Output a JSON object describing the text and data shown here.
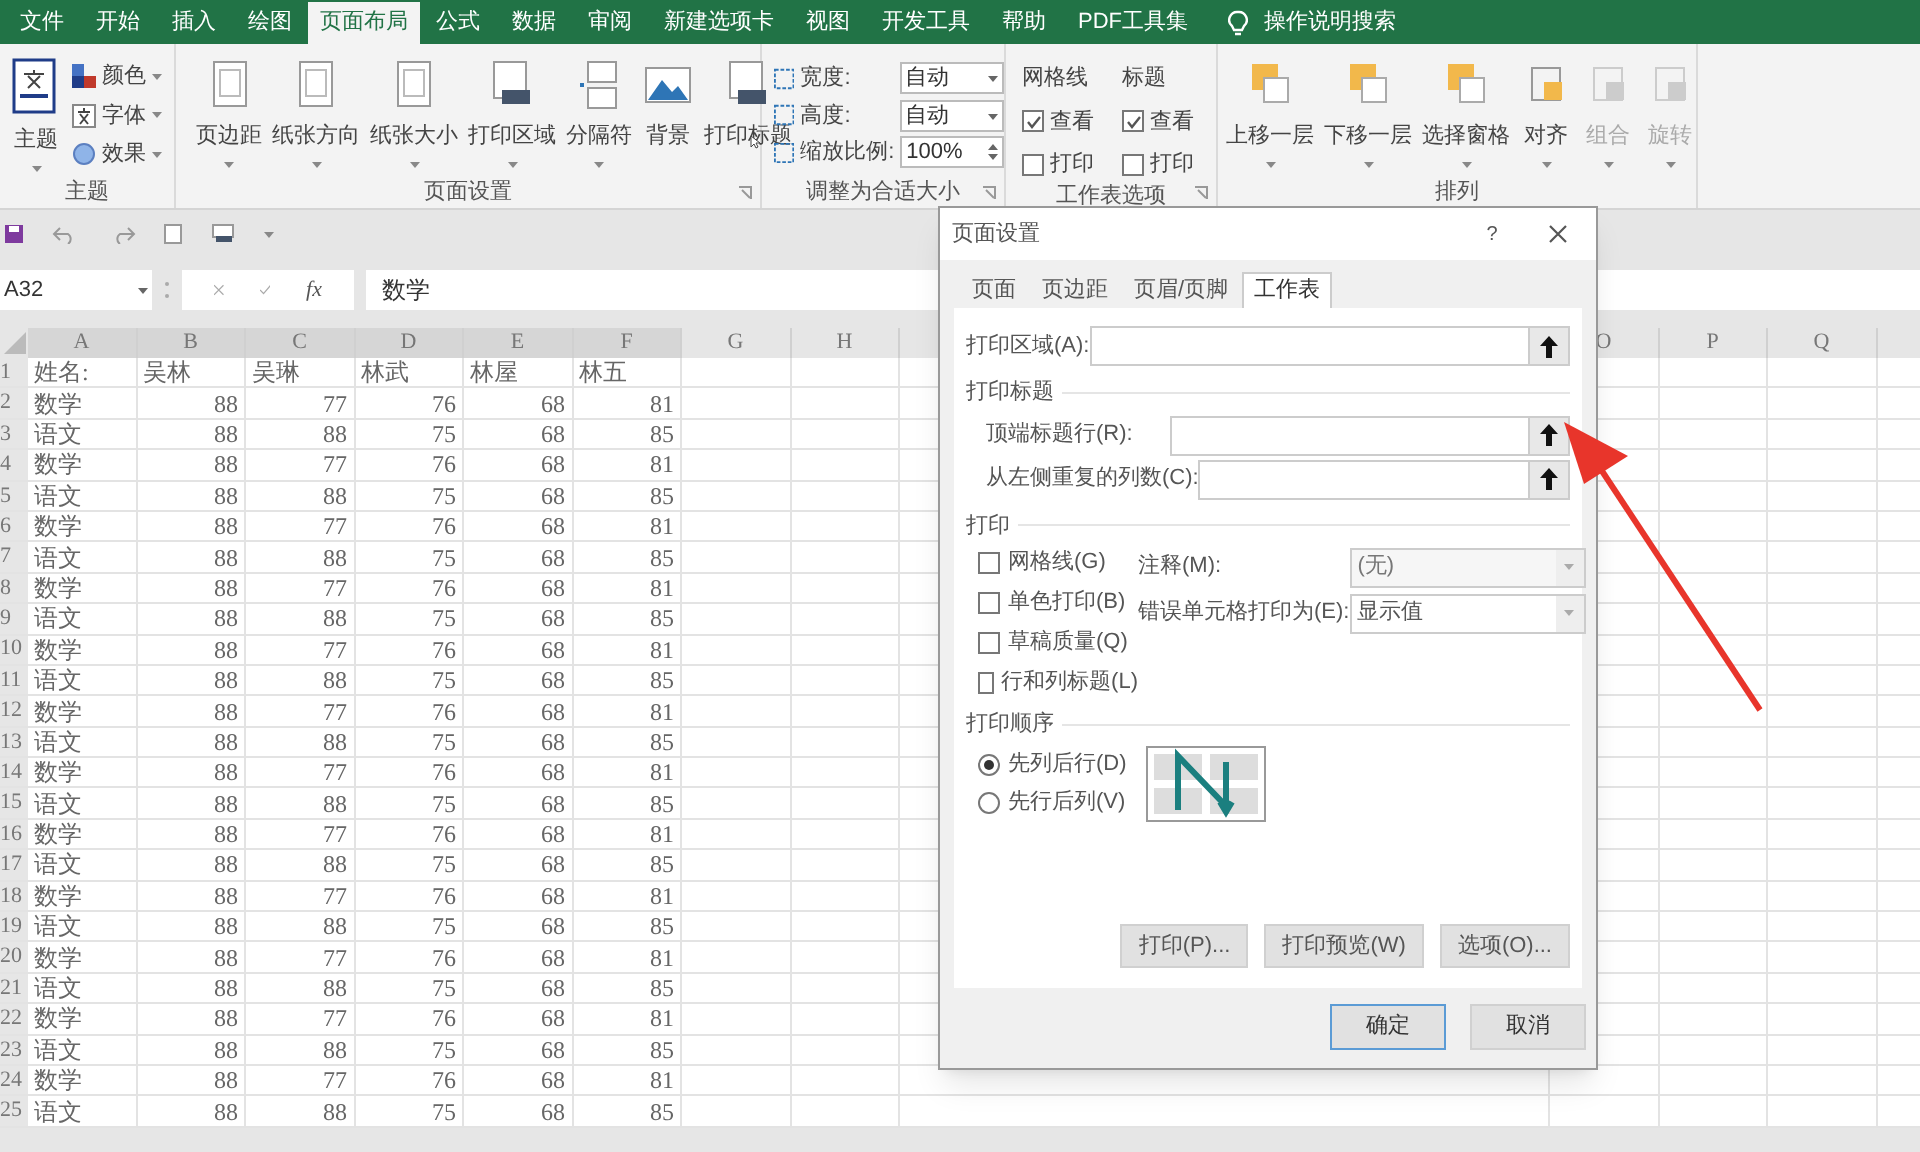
{
  "ribbon_tabs": [
    {
      "label": "文件",
      "selected": false
    },
    {
      "label": "开始",
      "selected": false
    },
    {
      "label": "插入",
      "selected": false
    },
    {
      "label": "绘图",
      "selected": false
    },
    {
      "label": "页面布局",
      "selected": true
    },
    {
      "label": "公式",
      "selected": false
    },
    {
      "label": "数据",
      "selected": false
    },
    {
      "label": "审阅",
      "selected": false
    },
    {
      "label": "新建选项卡",
      "selected": false
    },
    {
      "label": "视图",
      "selected": false
    },
    {
      "label": "开发工具",
      "selected": false
    },
    {
      "label": "帮助",
      "selected": false
    },
    {
      "label": "PDF工具集",
      "selected": false
    }
  ],
  "tell_me": "操作说明搜索",
  "theme_group": {
    "label": "主题",
    "button": "主题",
    "items": [
      "颜色",
      "字体",
      "效果"
    ]
  },
  "page_setup_group": {
    "label": "页面设置",
    "buttons": [
      "页边距",
      "纸张方向",
      "纸张大小",
      "打印区域",
      "分隔符",
      "背景",
      "打印标题"
    ]
  },
  "scale_group": {
    "label": "调整为合适大小",
    "fields": [
      {
        "label": "宽度:",
        "value": "自动"
      },
      {
        "label": "高度:",
        "value": "自动"
      },
      {
        "label": "缩放比例:",
        "value": "100%"
      }
    ]
  },
  "sheet_options_group": {
    "label": "工作表选项",
    "columns": [
      {
        "title": "网格线",
        "view_checked": true,
        "view": "查看",
        "print_checked": false,
        "print": "打印"
      },
      {
        "title": "标题",
        "view_checked": true,
        "view": "查看",
        "print_checked": false,
        "print": "打印"
      }
    ]
  },
  "arrange_group": {
    "label": "排列",
    "buttons": [
      {
        "label": "上移一层",
        "disabled": false
      },
      {
        "label": "下移一层",
        "disabled": false
      },
      {
        "label": "选择窗格",
        "disabled": false
      },
      {
        "label": "对齐",
        "disabled": false
      },
      {
        "label": "组合",
        "disabled": true
      },
      {
        "label": "旋转",
        "disabled": true
      }
    ]
  },
  "formula_bar": {
    "name_box": "A32",
    "function_label": "fx",
    "content": "数学"
  },
  "sheet": {
    "columns_left": [
      "A",
      "B",
      "C",
      "D",
      "E",
      "F",
      "G",
      "H"
    ],
    "columns_right": [
      "O",
      "P",
      "Q"
    ],
    "rows": [
      {
        "number": "1",
        "cells": [
          "姓名:",
          "吴林",
          "吴琳",
          "林武",
          "林屋",
          "林五"
        ]
      },
      {
        "number": "2",
        "cells": [
          "数学",
          "88",
          "77",
          "76",
          "68",
          "81"
        ]
      },
      {
        "number": "3",
        "cells": [
          "语文",
          "88",
          "88",
          "75",
          "68",
          "85"
        ]
      },
      {
        "number": "4",
        "cells": [
          "数学",
          "88",
          "77",
          "76",
          "68",
          "81"
        ]
      },
      {
        "number": "5",
        "cells": [
          "语文",
          "88",
          "88",
          "75",
          "68",
          "85"
        ]
      },
      {
        "number": "6",
        "cells": [
          "数学",
          "88",
          "77",
          "76",
          "68",
          "81"
        ]
      },
      {
        "number": "7",
        "cells": [
          "语文",
          "88",
          "88",
          "75",
          "68",
          "85"
        ]
      },
      {
        "number": "8",
        "cells": [
          "数学",
          "88",
          "77",
          "76",
          "68",
          "81"
        ]
      },
      {
        "number": "9",
        "cells": [
          "语文",
          "88",
          "88",
          "75",
          "68",
          "85"
        ]
      },
      {
        "number": "10",
        "cells": [
          "数学",
          "88",
          "77",
          "76",
          "68",
          "81"
        ]
      },
      {
        "number": "11",
        "cells": [
          "语文",
          "88",
          "88",
          "75",
          "68",
          "85"
        ]
      },
      {
        "number": "12",
        "cells": [
          "数学",
          "88",
          "77",
          "76",
          "68",
          "81"
        ]
      },
      {
        "number": "13",
        "cells": [
          "语文",
          "88",
          "88",
          "75",
          "68",
          "85"
        ]
      },
      {
        "number": "14",
        "cells": [
          "数学",
          "88",
          "77",
          "76",
          "68",
          "81"
        ]
      },
      {
        "number": "15",
        "cells": [
          "语文",
          "88",
          "88",
          "75",
          "68",
          "85"
        ]
      },
      {
        "number": "16",
        "cells": [
          "数学",
          "88",
          "77",
          "76",
          "68",
          "81"
        ]
      },
      {
        "number": "17",
        "cells": [
          "语文",
          "88",
          "88",
          "75",
          "68",
          "85"
        ]
      },
      {
        "number": "18",
        "cells": [
          "数学",
          "88",
          "77",
          "76",
          "68",
          "81"
        ]
      },
      {
        "number": "19",
        "cells": [
          "语文",
          "88",
          "88",
          "75",
          "68",
          "85"
        ]
      },
      {
        "number": "20",
        "cells": [
          "数学",
          "88",
          "77",
          "76",
          "68",
          "81"
        ]
      },
      {
        "number": "21",
        "cells": [
          "语文",
          "88",
          "88",
          "75",
          "68",
          "85"
        ]
      },
      {
        "number": "22",
        "cells": [
          "数学",
          "88",
          "77",
          "76",
          "68",
          "81"
        ]
      },
      {
        "number": "23",
        "cells": [
          "语文",
          "88",
          "88",
          "75",
          "68",
          "85"
        ]
      },
      {
        "number": "24",
        "cells": [
          "数学",
          "88",
          "77",
          "76",
          "68",
          "81"
        ]
      },
      {
        "number": "25",
        "cells": [
          "语文",
          "88",
          "88",
          "75",
          "68",
          "85"
        ]
      }
    ]
  },
  "dialog": {
    "title": "页面设置",
    "help": "?",
    "tabs": [
      {
        "label": "页面",
        "selected": false
      },
      {
        "label": "页边距",
        "selected": false
      },
      {
        "label": "页眉/页脚",
        "selected": false
      },
      {
        "label": "工作表",
        "selected": true
      }
    ],
    "print_area_label": "打印区域(A):",
    "print_titles_heading": "打印标题",
    "title_fields": [
      {
        "label": "顶端标题行(R):"
      },
      {
        "label": "从左侧重复的列数(C):"
      }
    ],
    "print_heading": "打印",
    "checkboxes": [
      {
        "label": "网格线(G)",
        "checked": false
      },
      {
        "label": "单色打印(B)",
        "checked": false
      },
      {
        "label": "草稿质量(Q)",
        "checked": false
      },
      {
        "label": "行和列标题(L)",
        "checked": false
      }
    ],
    "dropdowns": [
      {
        "label": "注释(M):",
        "value": "(无)",
        "disabled": true
      },
      {
        "label": "错误单元格打印为(E):",
        "value": "显示值",
        "disabled": false
      }
    ],
    "order_heading": "打印顺序",
    "order_options": [
      {
        "label": "先列后行(D)",
        "selected": true
      },
      {
        "label": "先行后列(V)",
        "selected": false
      }
    ],
    "action_buttons": [
      "打印(P)...",
      "打印预览(W)",
      "选项(O)..."
    ],
    "ok": "确定",
    "cancel": "取消"
  }
}
